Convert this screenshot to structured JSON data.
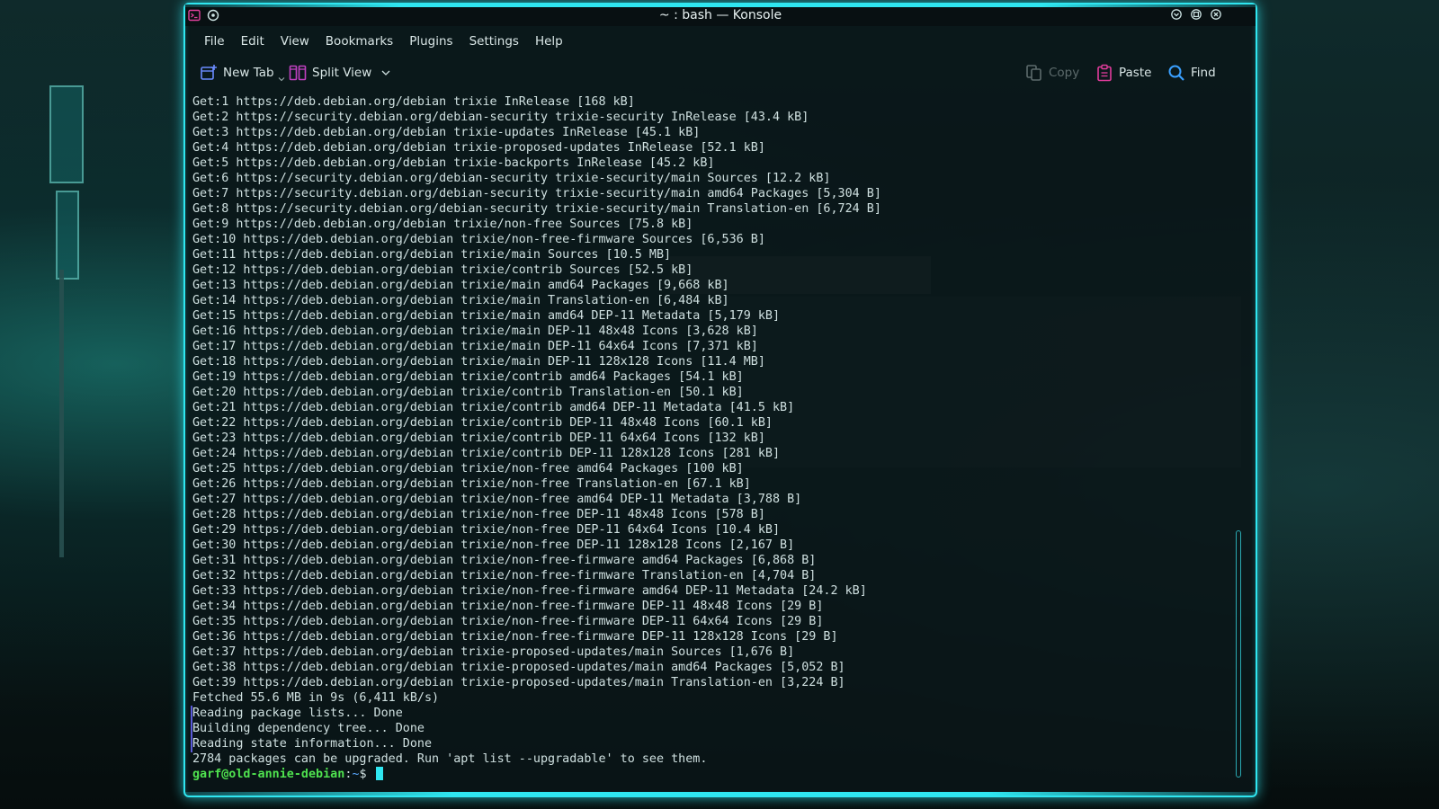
{
  "window": {
    "title": "~ : bash — Konsole"
  },
  "menu": [
    "File",
    "Edit",
    "View",
    "Bookmarks",
    "Plugins",
    "Settings",
    "Help"
  ],
  "toolbar": {
    "new_tab": "New Tab",
    "split_view": "Split View",
    "copy": "Copy",
    "paste": "Paste",
    "find": "Find"
  },
  "colors": {
    "accent": "#2fe6f0",
    "prompt_user": "#4fe24f",
    "prompt_path": "#5aa9ff",
    "paste_icon": "#e23c9c",
    "find_icon": "#3aa0ff",
    "new_tab_icon": "#6b8cff",
    "split_icon": "#c040c0"
  },
  "terminal": {
    "lines": [
      "Get:1 https://deb.debian.org/debian trixie InRelease [168 kB]",
      "Get:2 https://security.debian.org/debian-security trixie-security InRelease [43.4 kB]",
      "Get:3 https://deb.debian.org/debian trixie-updates InRelease [45.1 kB]",
      "Get:4 https://deb.debian.org/debian trixie-proposed-updates InRelease [52.1 kB]",
      "Get:5 https://deb.debian.org/debian trixie-backports InRelease [45.2 kB]",
      "Get:6 https://security.debian.org/debian-security trixie-security/main Sources [12.2 kB]",
      "Get:7 https://security.debian.org/debian-security trixie-security/main amd64 Packages [5,304 B]",
      "Get:8 https://security.debian.org/debian-security trixie-security/main Translation-en [6,724 B]",
      "Get:9 https://deb.debian.org/debian trixie/non-free Sources [75.8 kB]",
      "Get:10 https://deb.debian.org/debian trixie/non-free-firmware Sources [6,536 B]",
      "Get:11 https://deb.debian.org/debian trixie/main Sources [10.5 MB]",
      "Get:12 https://deb.debian.org/debian trixie/contrib Sources [52.5 kB]",
      "Get:13 https://deb.debian.org/debian trixie/main amd64 Packages [9,668 kB]",
      "Get:14 https://deb.debian.org/debian trixie/main Translation-en [6,484 kB]",
      "Get:15 https://deb.debian.org/debian trixie/main amd64 DEP-11 Metadata [5,179 kB]",
      "Get:16 https://deb.debian.org/debian trixie/main DEP-11 48x48 Icons [3,628 kB]",
      "Get:17 https://deb.debian.org/debian trixie/main DEP-11 64x64 Icons [7,371 kB]",
      "Get:18 https://deb.debian.org/debian trixie/main DEP-11 128x128 Icons [11.4 MB]",
      "Get:19 https://deb.debian.org/debian trixie/contrib amd64 Packages [54.1 kB]",
      "Get:20 https://deb.debian.org/debian trixie/contrib Translation-en [50.1 kB]",
      "Get:21 https://deb.debian.org/debian trixie/contrib amd64 DEP-11 Metadata [41.5 kB]",
      "Get:22 https://deb.debian.org/debian trixie/contrib DEP-11 48x48 Icons [60.1 kB]",
      "Get:23 https://deb.debian.org/debian trixie/contrib DEP-11 64x64 Icons [132 kB]",
      "Get:24 https://deb.debian.org/debian trixie/contrib DEP-11 128x128 Icons [281 kB]",
      "Get:25 https://deb.debian.org/debian trixie/non-free amd64 Packages [100 kB]",
      "Get:26 https://deb.debian.org/debian trixie/non-free Translation-en [67.1 kB]",
      "Get:27 https://deb.debian.org/debian trixie/non-free amd64 DEP-11 Metadata [3,788 B]",
      "Get:28 https://deb.debian.org/debian trixie/non-free DEP-11 48x48 Icons [578 B]",
      "Get:29 https://deb.debian.org/debian trixie/non-free DEP-11 64x64 Icons [10.4 kB]",
      "Get:30 https://deb.debian.org/debian trixie/non-free DEP-11 128x128 Icons [2,167 B]",
      "Get:31 https://deb.debian.org/debian trixie/non-free-firmware amd64 Packages [6,868 B]",
      "Get:32 https://deb.debian.org/debian trixie/non-free-firmware Translation-en [4,704 B]",
      "Get:33 https://deb.debian.org/debian trixie/non-free-firmware amd64 DEP-11 Metadata [24.2 kB]",
      "Get:34 https://deb.debian.org/debian trixie/non-free-firmware DEP-11 48x48 Icons [29 B]",
      "Get:35 https://deb.debian.org/debian trixie/non-free-firmware DEP-11 64x64 Icons [29 B]",
      "Get:36 https://deb.debian.org/debian trixie/non-free-firmware DEP-11 128x128 Icons [29 B]",
      "Get:37 https://deb.debian.org/debian trixie-proposed-updates/main Sources [1,676 B]",
      "Get:38 https://deb.debian.org/debian trixie-proposed-updates/main amd64 Packages [5,052 B]",
      "Get:39 https://deb.debian.org/debian trixie-proposed-updates/main Translation-en [3,224 B]",
      "Fetched 55.6 MB in 9s (6,411 kB/s)",
      "Reading package lists... Done",
      "Building dependency tree... Done",
      "Reading state information... Done",
      "2784 packages can be upgraded. Run 'apt list --upgradable' to see them."
    ],
    "prompt_user": "garf@old-annie-debian",
    "prompt_sep": ":",
    "prompt_path": "~",
    "prompt_symbol": "$"
  }
}
